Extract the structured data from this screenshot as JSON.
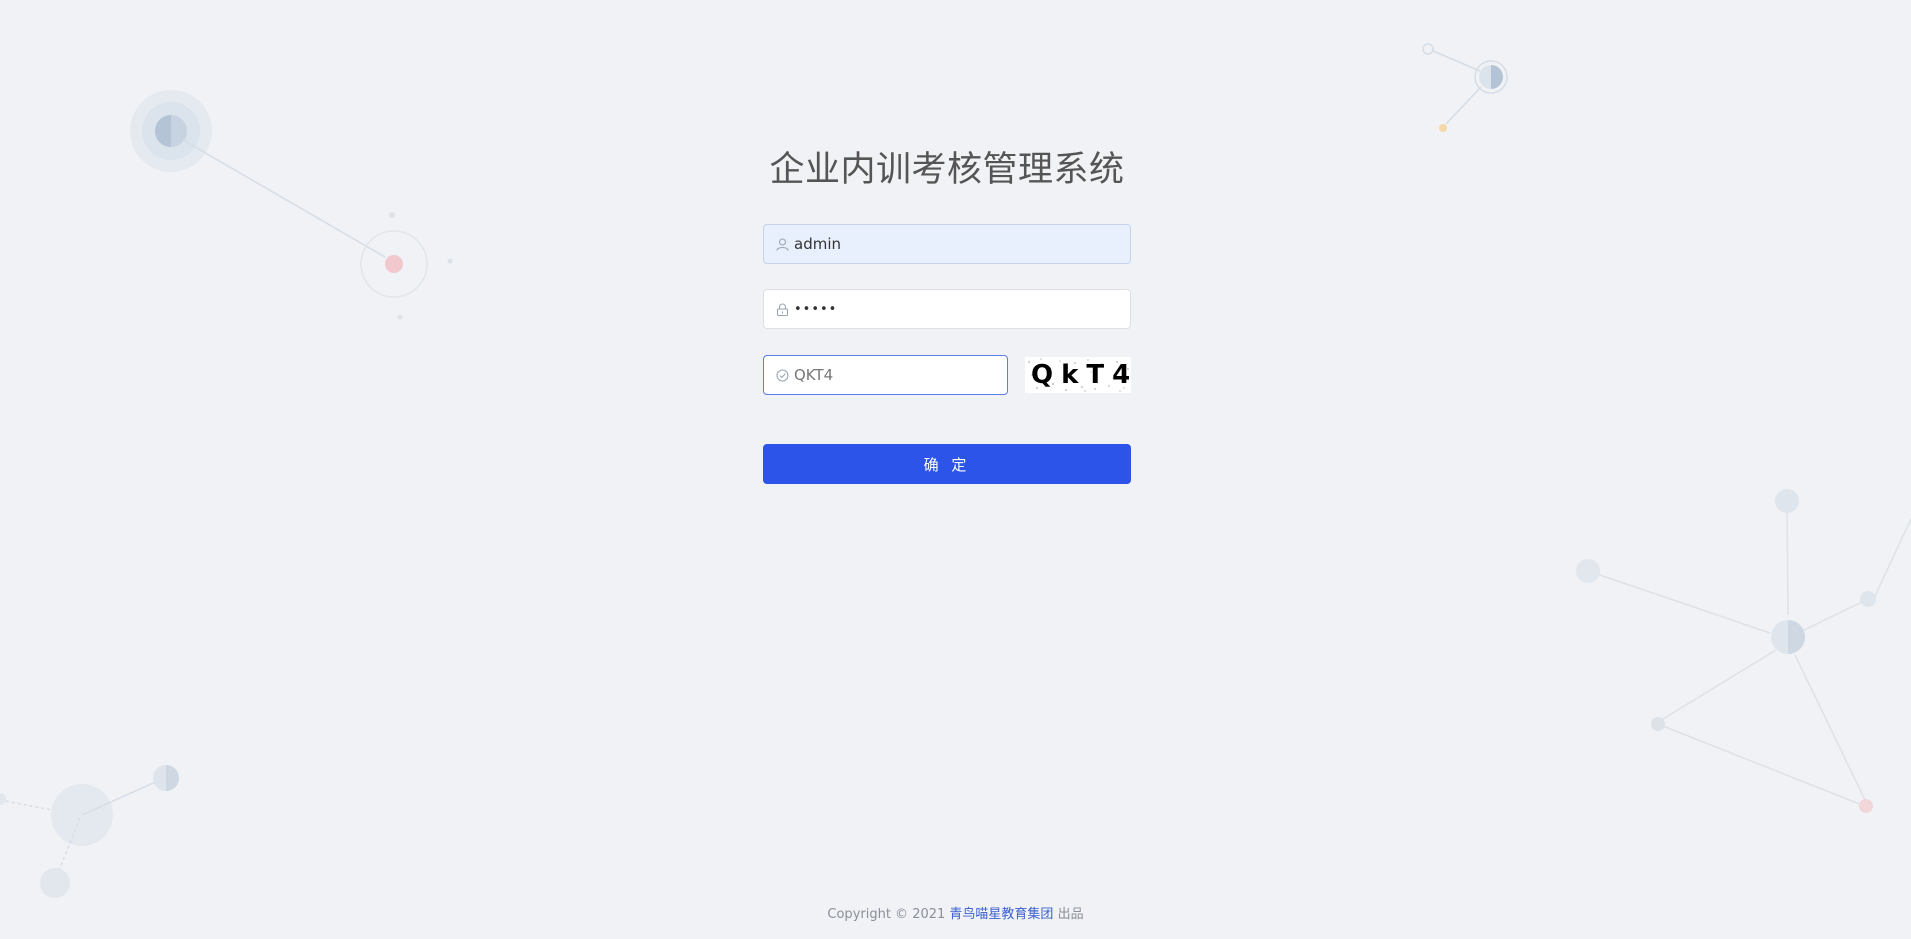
{
  "page": {
    "title": "企业内训考核管理系统"
  },
  "login_form": {
    "username": {
      "value": "admin",
      "icon": "user-icon"
    },
    "password": {
      "value": "abcde",
      "icon": "lock-icon"
    },
    "captcha": {
      "value": "QKT4",
      "icon": "check-circle-icon",
      "image_text": "QkT4"
    },
    "submit_label": "确 定"
  },
  "footer": {
    "prefix": "Copyright © 2021",
    "organization": "青鸟喵星教育集团",
    "suffix": "出品"
  },
  "colors": {
    "background": "#f0f2f5",
    "primary": "#2d54e8",
    "link": "#3a5fd0",
    "autofill": "#e8f0fe"
  }
}
